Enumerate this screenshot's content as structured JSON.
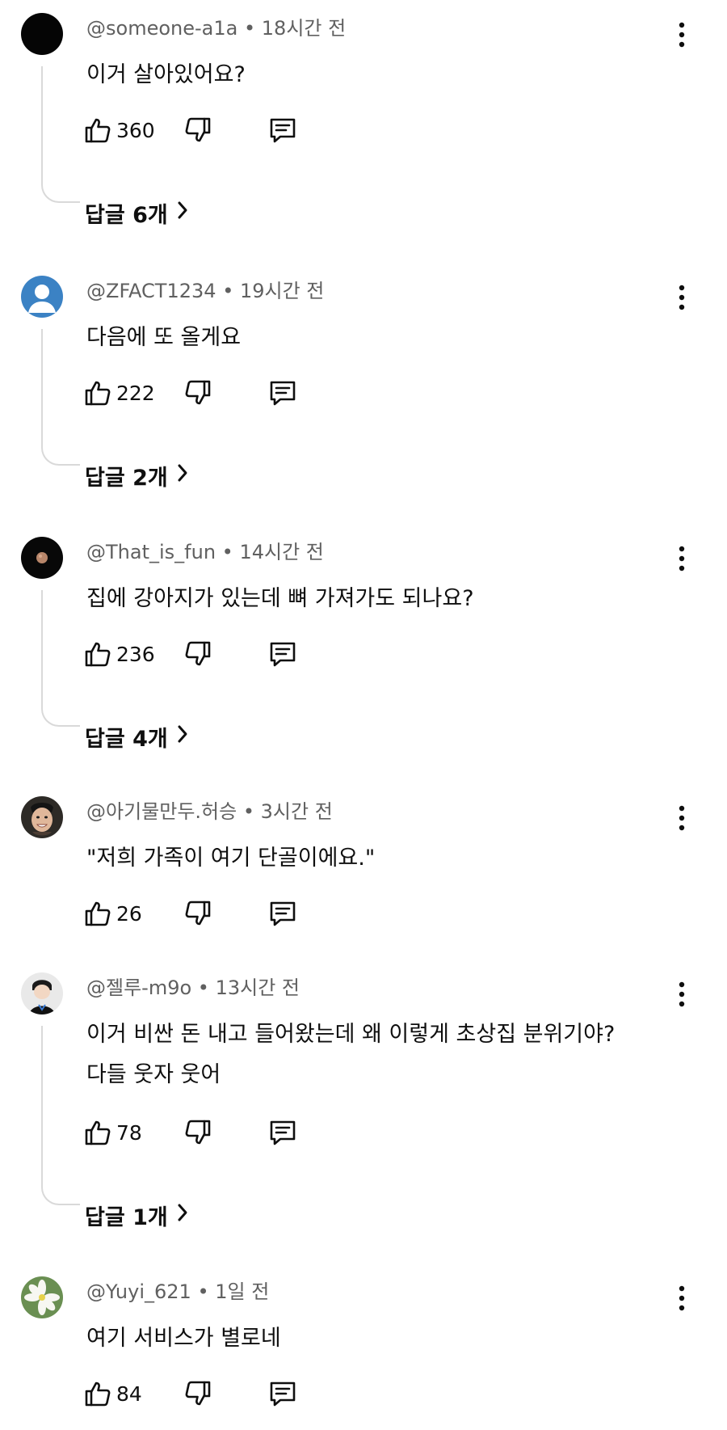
{
  "comments": [
    {
      "handle": "@someone-a1a",
      "time": "18시간 전",
      "lines": [
        "이거 살아있어요?"
      ],
      "likes": "360",
      "replies": "답글 6개",
      "avatar_icon": "black-circle-avatar"
    },
    {
      "handle": "@ZFACT1234",
      "time": "19시간 전",
      "lines": [
        "다음에 또 올게요"
      ],
      "likes": "222",
      "replies": "답글 2개",
      "avatar_icon": "default-person-avatar"
    },
    {
      "handle": "@That_is_fun",
      "time": "14시간 전",
      "lines": [
        "집에 강아지가 있는데 뼈 가져가도 되나요?"
      ],
      "likes": "236",
      "replies": "답글 4개",
      "avatar_icon": "moon-avatar"
    },
    {
      "handle": "@아기물만두.허승",
      "time": "3시간 전",
      "lines": [
        "\"저희 가족이 여기 단골이에요.\""
      ],
      "likes": "26",
      "avatar_icon": "face-photo-avatar"
    },
    {
      "handle": "@젤루-m9o",
      "time": "13시간 전",
      "lines": [
        "이거 비싼 돈 내고 들어왔는데 왜 이렇게 초상집 분위기야?",
        "다들 웃자 웃어"
      ],
      "likes": "78",
      "replies": "답글 1개",
      "avatar_icon": "character-avatar"
    },
    {
      "handle": "@Yuyi_621",
      "time": "1일 전",
      "lines": [
        "여기 서비스가 별로네"
      ],
      "likes": "84",
      "avatar_icon": "flower-avatar"
    }
  ],
  "icons": {
    "like": "thumbs-up-icon",
    "dislike": "thumbs-down-icon",
    "reply": "reply-comment-icon",
    "menu": "more-vertical-icon",
    "chevron": "chevron-right-icon"
  },
  "colors": {
    "text": "#0f0f0f",
    "meta": "#606060",
    "thread_line": "#d9d9d9",
    "default_avatar": "#3b82c4"
  }
}
